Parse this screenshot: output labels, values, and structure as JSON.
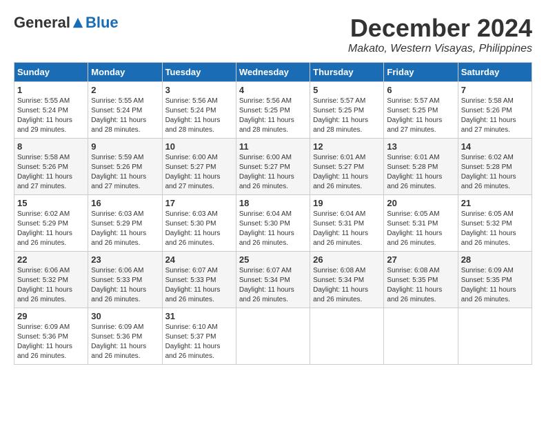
{
  "logo": {
    "general": "General",
    "blue": "Blue"
  },
  "title": "December 2024",
  "location": "Makato, Western Visayas, Philippines",
  "days_header": [
    "Sunday",
    "Monday",
    "Tuesday",
    "Wednesday",
    "Thursday",
    "Friday",
    "Saturday"
  ],
  "weeks": [
    [
      {
        "day": "1",
        "sunrise": "5:55 AM",
        "sunset": "5:24 PM",
        "daylight": "11 hours and 29 minutes."
      },
      {
        "day": "2",
        "sunrise": "5:55 AM",
        "sunset": "5:24 PM",
        "daylight": "11 hours and 28 minutes."
      },
      {
        "day": "3",
        "sunrise": "5:56 AM",
        "sunset": "5:24 PM",
        "daylight": "11 hours and 28 minutes."
      },
      {
        "day": "4",
        "sunrise": "5:56 AM",
        "sunset": "5:25 PM",
        "daylight": "11 hours and 28 minutes."
      },
      {
        "day": "5",
        "sunrise": "5:57 AM",
        "sunset": "5:25 PM",
        "daylight": "11 hours and 28 minutes."
      },
      {
        "day": "6",
        "sunrise": "5:57 AM",
        "sunset": "5:25 PM",
        "daylight": "11 hours and 27 minutes."
      },
      {
        "day": "7",
        "sunrise": "5:58 AM",
        "sunset": "5:26 PM",
        "daylight": "11 hours and 27 minutes."
      }
    ],
    [
      {
        "day": "8",
        "sunrise": "5:58 AM",
        "sunset": "5:26 PM",
        "daylight": "11 hours and 27 minutes."
      },
      {
        "day": "9",
        "sunrise": "5:59 AM",
        "sunset": "5:26 PM",
        "daylight": "11 hours and 27 minutes."
      },
      {
        "day": "10",
        "sunrise": "6:00 AM",
        "sunset": "5:27 PM",
        "daylight": "11 hours and 27 minutes."
      },
      {
        "day": "11",
        "sunrise": "6:00 AM",
        "sunset": "5:27 PM",
        "daylight": "11 hours and 26 minutes."
      },
      {
        "day": "12",
        "sunrise": "6:01 AM",
        "sunset": "5:27 PM",
        "daylight": "11 hours and 26 minutes."
      },
      {
        "day": "13",
        "sunrise": "6:01 AM",
        "sunset": "5:28 PM",
        "daylight": "11 hours and 26 minutes."
      },
      {
        "day": "14",
        "sunrise": "6:02 AM",
        "sunset": "5:28 PM",
        "daylight": "11 hours and 26 minutes."
      }
    ],
    [
      {
        "day": "15",
        "sunrise": "6:02 AM",
        "sunset": "5:29 PM",
        "daylight": "11 hours and 26 minutes."
      },
      {
        "day": "16",
        "sunrise": "6:03 AM",
        "sunset": "5:29 PM",
        "daylight": "11 hours and 26 minutes."
      },
      {
        "day": "17",
        "sunrise": "6:03 AM",
        "sunset": "5:30 PM",
        "daylight": "11 hours and 26 minutes."
      },
      {
        "day": "18",
        "sunrise": "6:04 AM",
        "sunset": "5:30 PM",
        "daylight": "11 hours and 26 minutes."
      },
      {
        "day": "19",
        "sunrise": "6:04 AM",
        "sunset": "5:31 PM",
        "daylight": "11 hours and 26 minutes."
      },
      {
        "day": "20",
        "sunrise": "6:05 AM",
        "sunset": "5:31 PM",
        "daylight": "11 hours and 26 minutes."
      },
      {
        "day": "21",
        "sunrise": "6:05 AM",
        "sunset": "5:32 PM",
        "daylight": "11 hours and 26 minutes."
      }
    ],
    [
      {
        "day": "22",
        "sunrise": "6:06 AM",
        "sunset": "5:32 PM",
        "daylight": "11 hours and 26 minutes."
      },
      {
        "day": "23",
        "sunrise": "6:06 AM",
        "sunset": "5:33 PM",
        "daylight": "11 hours and 26 minutes."
      },
      {
        "day": "24",
        "sunrise": "6:07 AM",
        "sunset": "5:33 PM",
        "daylight": "11 hours and 26 minutes."
      },
      {
        "day": "25",
        "sunrise": "6:07 AM",
        "sunset": "5:34 PM",
        "daylight": "11 hours and 26 minutes."
      },
      {
        "day": "26",
        "sunrise": "6:08 AM",
        "sunset": "5:34 PM",
        "daylight": "11 hours and 26 minutes."
      },
      {
        "day": "27",
        "sunrise": "6:08 AM",
        "sunset": "5:35 PM",
        "daylight": "11 hours and 26 minutes."
      },
      {
        "day": "28",
        "sunrise": "6:09 AM",
        "sunset": "5:35 PM",
        "daylight": "11 hours and 26 minutes."
      }
    ],
    [
      {
        "day": "29",
        "sunrise": "6:09 AM",
        "sunset": "5:36 PM",
        "daylight": "11 hours and 26 minutes."
      },
      {
        "day": "30",
        "sunrise": "6:09 AM",
        "sunset": "5:36 PM",
        "daylight": "11 hours and 26 minutes."
      },
      {
        "day": "31",
        "sunrise": "6:10 AM",
        "sunset": "5:37 PM",
        "daylight": "11 hours and 26 minutes."
      },
      null,
      null,
      null,
      null
    ]
  ]
}
